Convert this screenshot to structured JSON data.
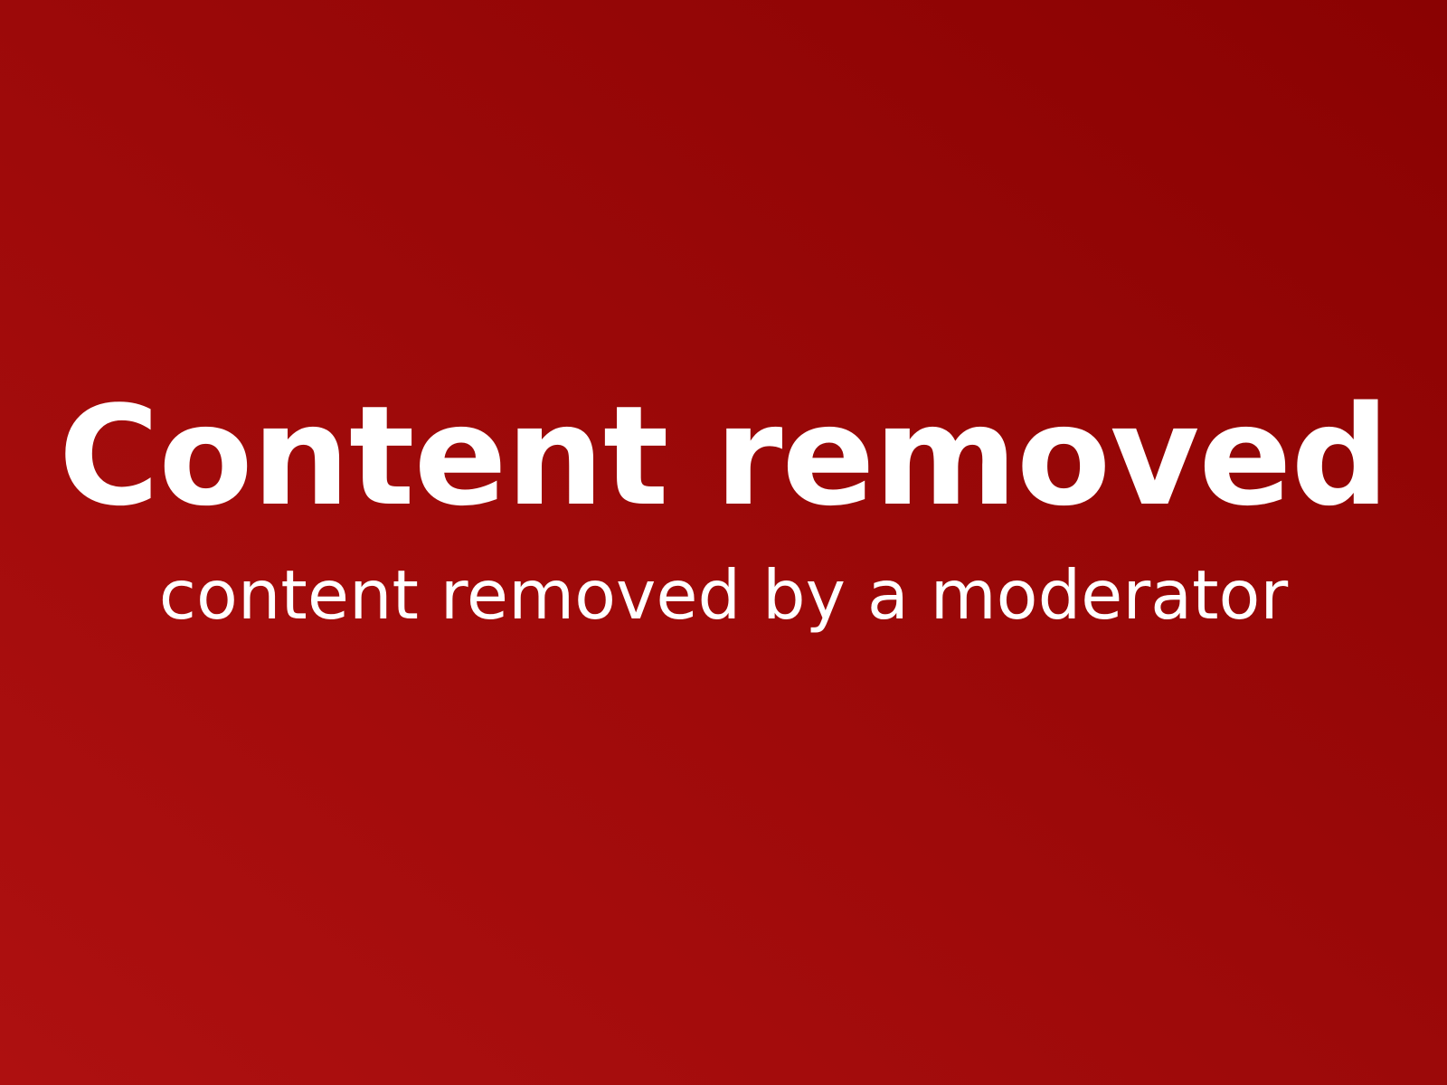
{
  "notice": {
    "title": "Content removed",
    "subtitle": "content removed by a moderator"
  },
  "colors": {
    "background_light": "#ae1010",
    "background_dark": "#8a0202",
    "text": "#ffffff"
  }
}
